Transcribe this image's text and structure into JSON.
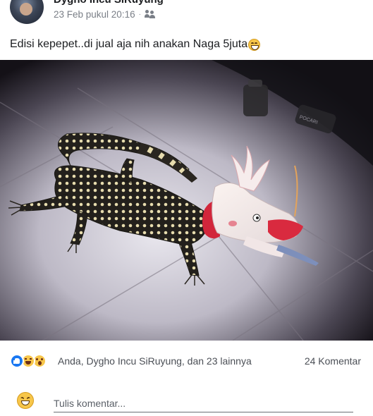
{
  "post": {
    "author_name": "Dygho Incu SiRuyung",
    "timestamp": "23 Feb pukul 20:16",
    "separator": "·",
    "privacy_icon": "friends-icon",
    "more_icon": "more-options-icon",
    "text": "Edisi kepepet..di jual aja nih anakan Naga 5juta",
    "text_emoji": "grinning-squinting-face-emoji"
  },
  "photo": {
    "subject": "monitor-lizard-with-dragon-head-costume",
    "bottle_label": "POCARI"
  },
  "reactions": {
    "icons": [
      "like-reaction-icon",
      "haha-reaction-icon",
      "wow-reaction-icon"
    ],
    "summary": "Anda, Dygho Incu SiRuyung, dan 23 lainnya",
    "comment_count": "24 Komentar"
  },
  "comment_box": {
    "emoji_icon": "grinning-squinting-face-emoji",
    "placeholder": "Tulis komentar..."
  },
  "colors": {
    "text": "#1c1e21",
    "meta": "#7a7f87",
    "like_blue": "#1877f2",
    "emoji_yellow": "#f7c64a"
  }
}
